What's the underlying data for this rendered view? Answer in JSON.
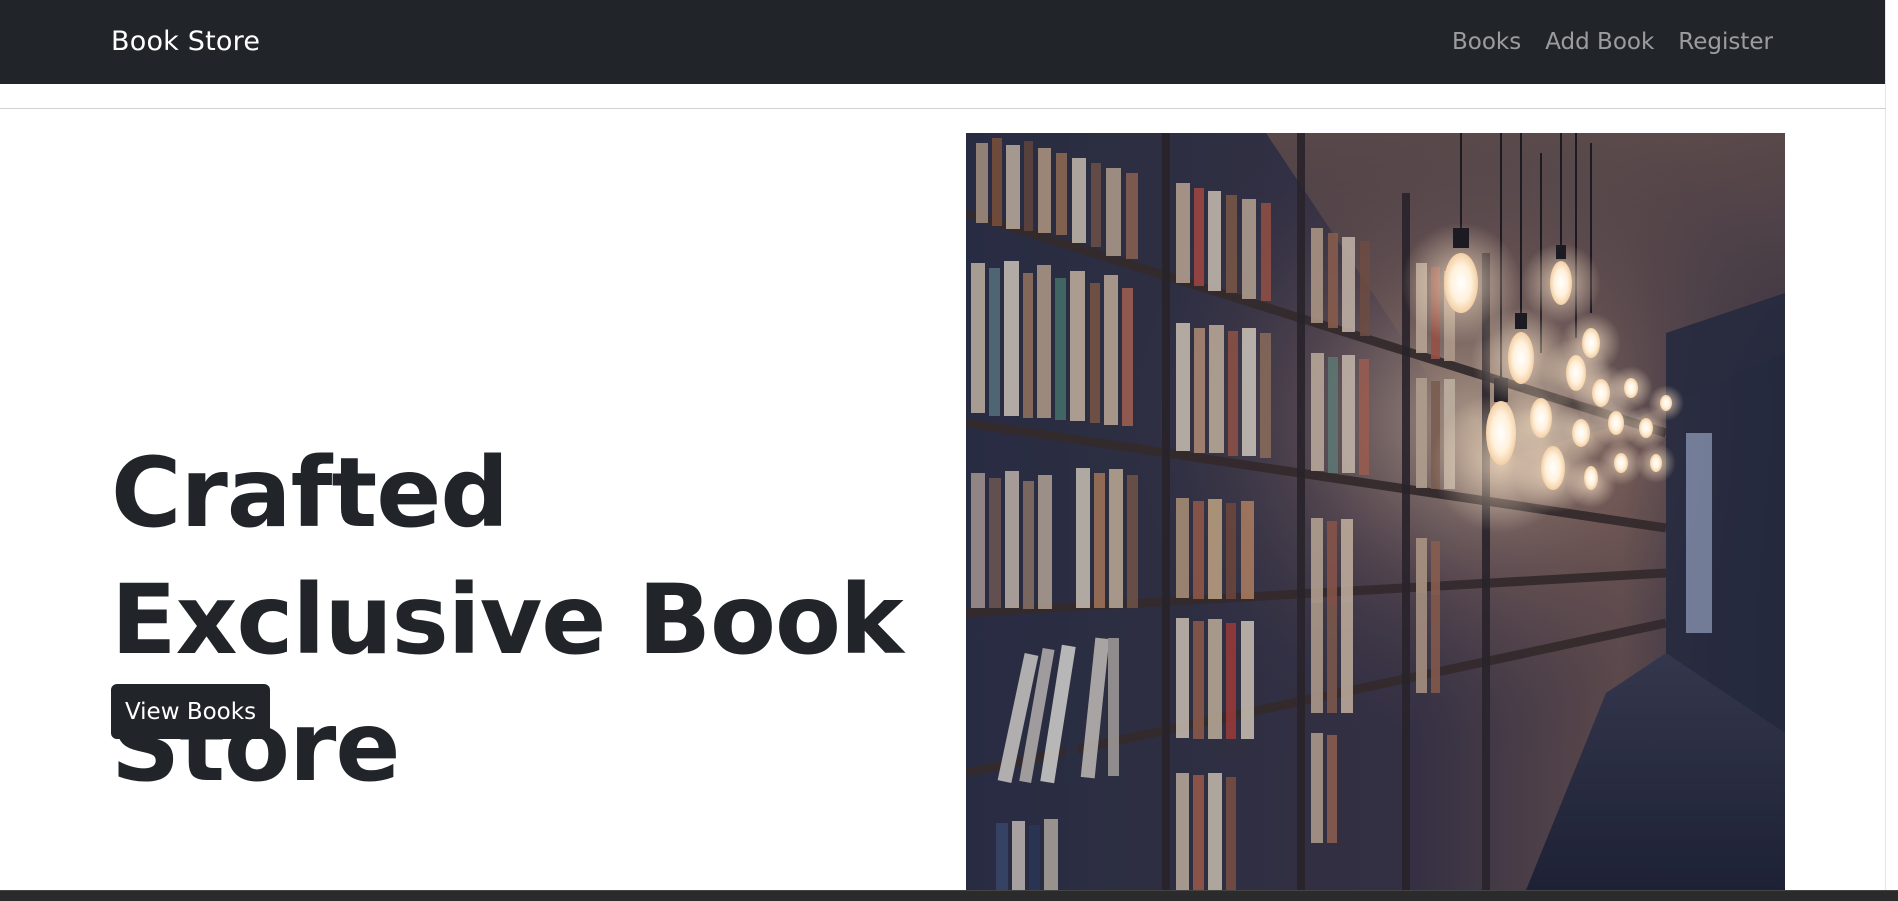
{
  "navbar": {
    "brand": "Book Store",
    "links": [
      "Books",
      "Add Book",
      "Register"
    ]
  },
  "hero": {
    "title": "Crafted Exclusive Book Store",
    "button_label": "View Books",
    "image_subject": "bookshelf-with-hanging-bulbs"
  },
  "colors": {
    "navbar_bg": "#212529",
    "text_dark": "#212529",
    "nav_link": "rgba(255,255,255,0.55)",
    "button_bg": "#212529"
  }
}
